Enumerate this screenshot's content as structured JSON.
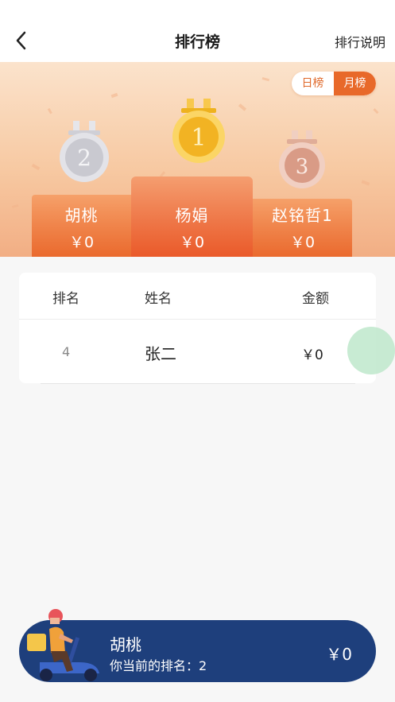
{
  "header": {
    "title": "排行榜",
    "rules_link": "排行说明"
  },
  "toggle": {
    "day": "日榜",
    "month": "月榜",
    "selected": "month"
  },
  "podium": {
    "first": {
      "rank": "1",
      "name": "杨娟",
      "amount": "￥0",
      "medal_color": "#f5b321"
    },
    "second": {
      "rank": "2",
      "name": "胡桃",
      "amount": "￥0",
      "medal_color": "#d8d8de"
    },
    "third": {
      "rank": "3",
      "name": "赵铭哲1",
      "amount": "￥0",
      "medal_color": "#e8b9a6"
    }
  },
  "table": {
    "headers": {
      "rank": "排名",
      "name": "姓名",
      "amount": "金额"
    },
    "rows": [
      {
        "rank": "4",
        "name": "张二",
        "amount": "￥0"
      }
    ]
  },
  "me": {
    "name": "胡桃",
    "rank_text": "你当前的排名：2",
    "amount": "￥0"
  },
  "colors": {
    "accent": "#e8692a",
    "bottom_bar": "#1e3f7c",
    "float_button": "#bae6c8"
  }
}
